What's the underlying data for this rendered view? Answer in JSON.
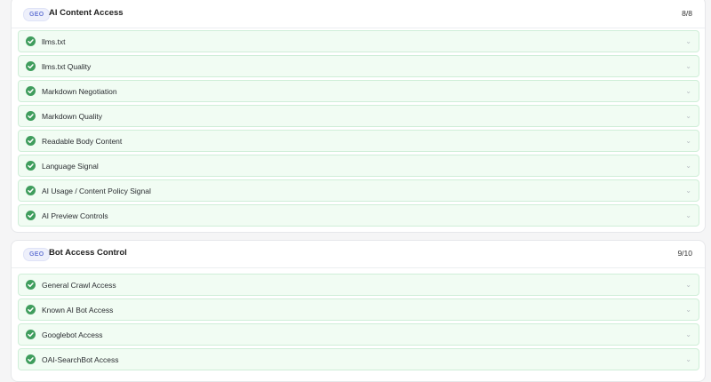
{
  "sections": [
    {
      "badge": "GEO",
      "title": "AI Content Access",
      "score": "8/8",
      "items": [
        {
          "label": "llms.txt"
        },
        {
          "label": "llms.txt Quality"
        },
        {
          "label": "Markdown Negotiation"
        },
        {
          "label": "Markdown Quality"
        },
        {
          "label": "Readable Body Content"
        },
        {
          "label": "Language Signal"
        },
        {
          "label": "AI Usage / Content Policy Signal"
        },
        {
          "label": "AI Preview Controls"
        }
      ]
    },
    {
      "badge": "GEO",
      "title": "Bot Access Control",
      "score": "9/10",
      "items": [
        {
          "label": "General Crawl Access"
        },
        {
          "label": "Known AI Bot Access"
        },
        {
          "label": "Googlebot Access"
        },
        {
          "label": "OAI-SearchBot Access"
        }
      ]
    }
  ],
  "icons": {
    "check": "check-circle-icon",
    "expand": "chevron-down-icon"
  },
  "colors": {
    "pass": "#3f9d5d",
    "pass_bg": "#f1fcf3",
    "badge": "#6b7bd6"
  }
}
